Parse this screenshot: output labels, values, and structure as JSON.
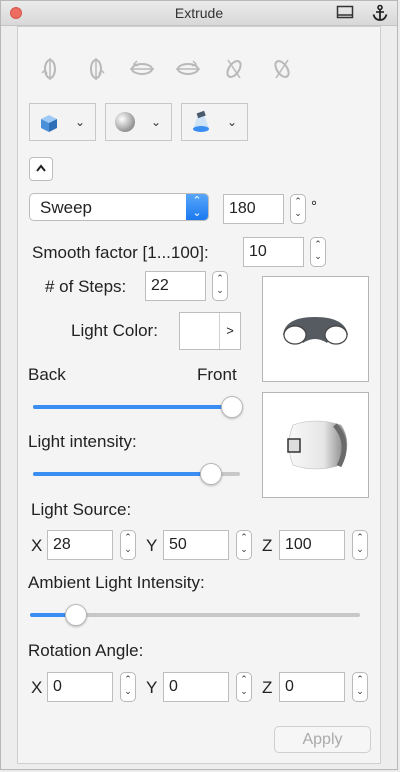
{
  "window": {
    "title": "Extrude"
  },
  "rotation_icons": [
    "rotate-x-ccw-icon",
    "rotate-x-cw-icon",
    "rotate-y-ccw-icon",
    "rotate-y-cw-icon",
    "rotate-z-ccw-icon",
    "rotate-z-cw-icon"
  ],
  "dropdowns": [
    {
      "name": "shape-dropdown",
      "icon": "cube-icon"
    },
    {
      "name": "material-dropdown",
      "icon": "sphere-icon"
    },
    {
      "name": "lighting-dropdown",
      "icon": "spotlight-icon"
    }
  ],
  "mode": {
    "value": "Sweep"
  },
  "sweep_angle": {
    "value": "180",
    "unit": "°"
  },
  "smooth": {
    "label": "Smooth factor [1...100]:",
    "value": "10"
  },
  "steps": {
    "label": "# of Steps:",
    "value": "22"
  },
  "light_color": {
    "label": "Light Color:",
    "arrow": ">"
  },
  "back_front": {
    "back": "Back",
    "front": "Front",
    "level": 0.96
  },
  "light_intensity": {
    "label": "Light intensity:",
    "level": 0.86
  },
  "light_source": {
    "label": "Light Source:",
    "x_label": "X",
    "x": "28",
    "y_label": "Y",
    "y": "50",
    "z_label": "Z",
    "z": "100"
  },
  "ambient": {
    "label": "Ambient Light Intensity:",
    "level": 0.14
  },
  "rotation_angle": {
    "label": "Rotation Angle:",
    "x_label": "X",
    "x": "0",
    "y_label": "Y",
    "y": "0",
    "z_label": "Z",
    "z": "0"
  },
  "apply_label": "Apply",
  "colors": {
    "accent": "#3a8df3",
    "close": "#ed6b5f"
  }
}
